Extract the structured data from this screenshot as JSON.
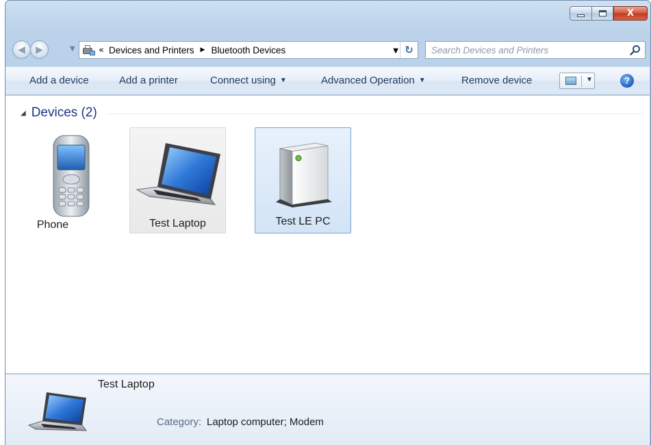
{
  "window": {
    "close_glyph": "X"
  },
  "nav": {
    "breadcrumb_overflow": "«",
    "breadcrumbs": [
      "Devices and Printers",
      "Bluetooth Devices"
    ],
    "search_placeholder": "Search Devices and Printers"
  },
  "toolbar": {
    "add_device": "Add a device",
    "add_printer": "Add a printer",
    "connect_using": "Connect using",
    "advanced_operation": "Advanced Operation",
    "remove_device": "Remove device",
    "help_glyph": "?"
  },
  "content": {
    "group_title": "Devices (2)",
    "devices": [
      {
        "name": "Phone",
        "icon": "phone-icon",
        "state": "normal"
      },
      {
        "name": "Test Laptop",
        "icon": "laptop-icon",
        "state": "hover"
      },
      {
        "name": "Test LE PC",
        "icon": "pc-tower-icon",
        "state": "selected"
      }
    ]
  },
  "details": {
    "name": "Test Laptop",
    "category_label": "Category:",
    "category_value": "Laptop computer; Modem",
    "icon": "laptop-icon"
  },
  "colors": {
    "window_frame": "#b9d1ea",
    "selection_fill": "#d3e4f6",
    "selection_border": "#7da2ce",
    "group_header": "#1e3287"
  }
}
